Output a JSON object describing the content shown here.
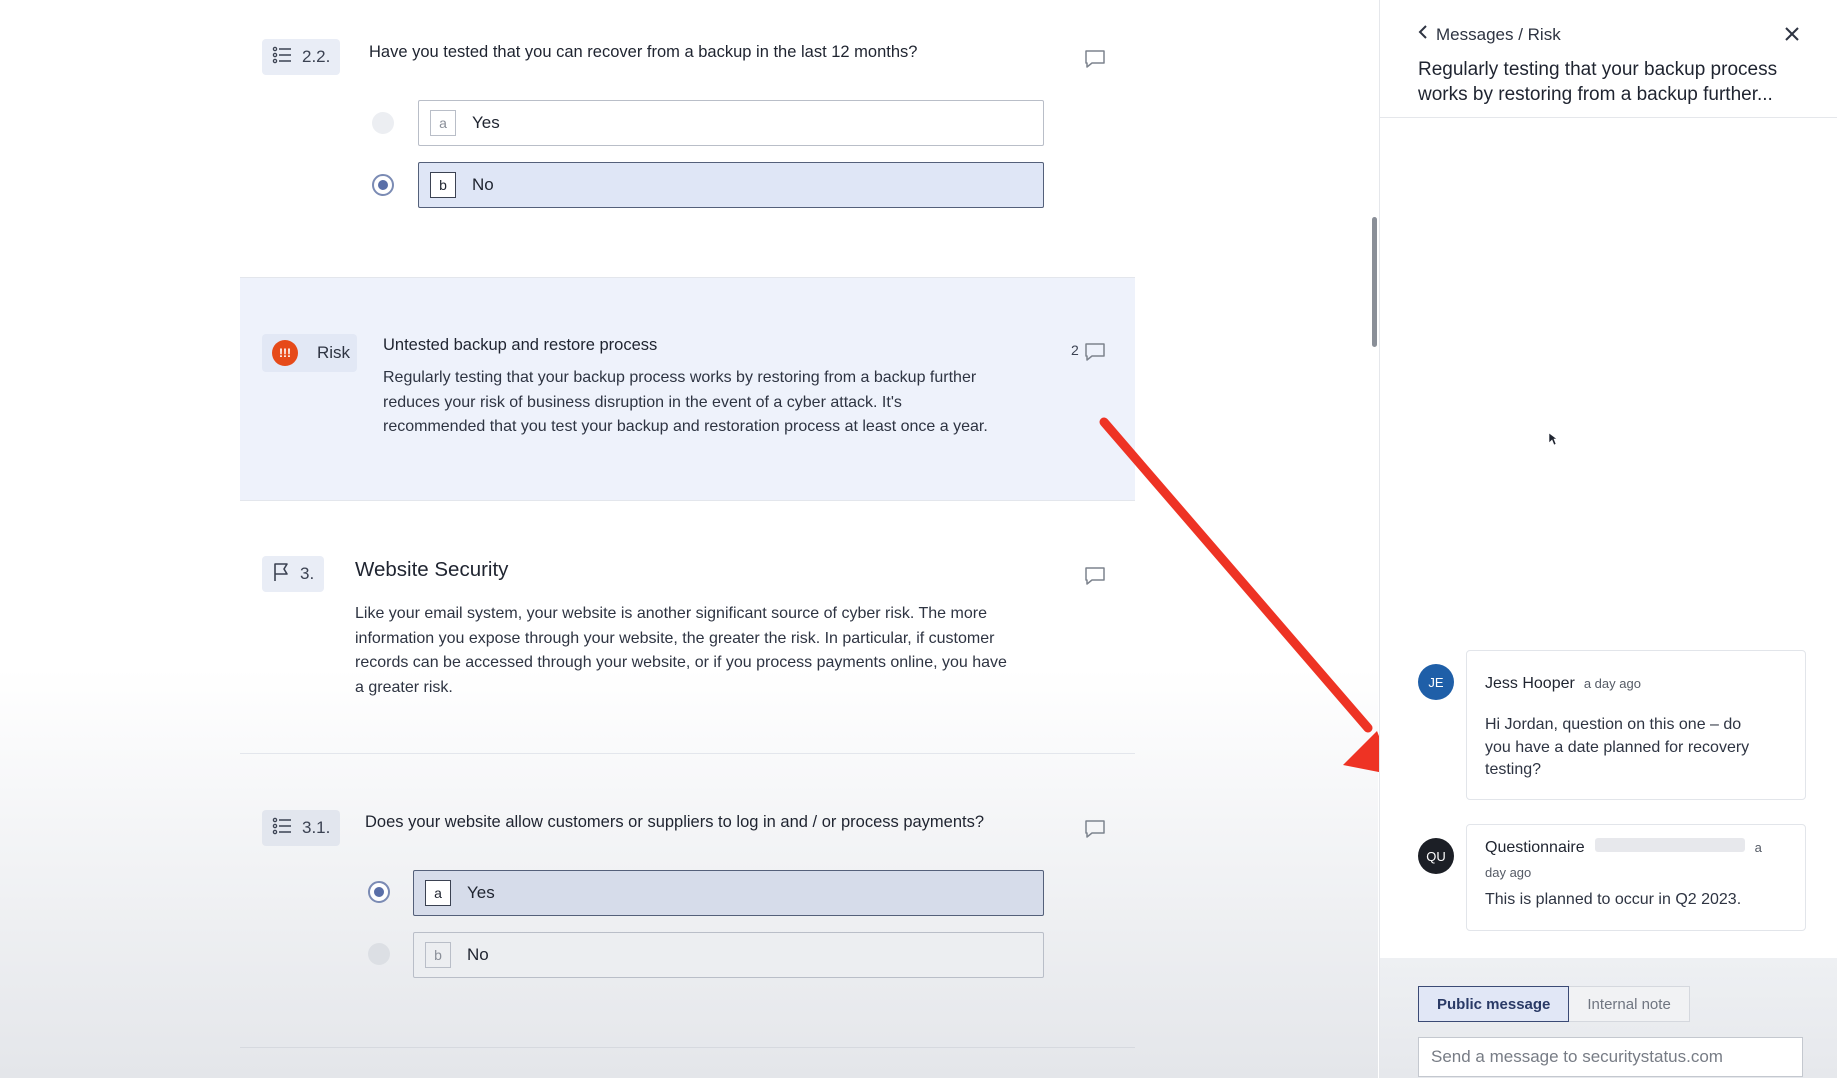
{
  "questions": {
    "q22": {
      "number": "2.2.",
      "text": "Have you tested that you can recover from a backup in the last 12 months?",
      "options": [
        {
          "key": "a",
          "label": "Yes",
          "selected": false
        },
        {
          "key": "b",
          "label": "No",
          "selected": true
        }
      ]
    },
    "risk": {
      "label": "Risk",
      "icon_text": "!!!",
      "title": "Untested backup and restore process",
      "body_lines": [
        "Regularly testing that your backup process works by restoring from a backup further",
        "reduces your risk of business disruption in the event of a cyber attack. It's",
        "recommended that you test your backup and restoration process at least once a year."
      ],
      "comment_count": "2"
    },
    "section3": {
      "number": "3.",
      "title": "Website Security",
      "body_lines": [
        "Like your email system, your website is another significant source of cyber risk. The more",
        "information you expose through your website, the greater the risk. In particular, if customer",
        "records can be accessed through your website, or if you process payments online, you have",
        "a greater risk."
      ]
    },
    "q31": {
      "number": "3.1.",
      "text": "Does your website allow customers or suppliers to log in and / or process payments?",
      "options": [
        {
          "key": "a",
          "label": "Yes",
          "selected": true
        },
        {
          "key": "b",
          "label": "No",
          "selected": false
        }
      ]
    }
  },
  "panel": {
    "breadcrumb": "Messages / Risk",
    "title_lines": [
      "Regularly testing that your backup process",
      "works by restoring from a backup further..."
    ],
    "messages": [
      {
        "initials": "JE",
        "avatar_color": "#1f5fa8",
        "name": "Jess Hooper",
        "time": "a day ago",
        "text_lines": [
          "Hi Jordan, question on this one – do",
          "you have a date planned for recovery",
          "testing?"
        ]
      },
      {
        "initials": "QU",
        "avatar_color": "#1c1f26",
        "name": "Questionnaire",
        "time_line1": "a",
        "time_line2": "day ago",
        "text_lines": [
          "This is planned to occur in Q2 2023."
        ]
      }
    ],
    "tabs": {
      "public": "Public message",
      "internal": "Internal note"
    },
    "input_placeholder": "Send a message to securitystatus.com"
  },
  "annotation": {
    "arrow_color": "#ee3324"
  },
  "colors": {
    "accent": "#5a6fa8",
    "risk": "#e64a19"
  }
}
